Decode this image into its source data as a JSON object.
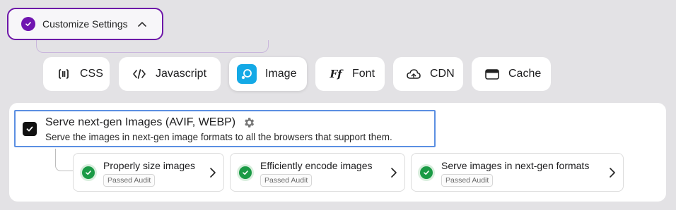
{
  "customize": {
    "label": "Customize Settings"
  },
  "tabs": [
    {
      "label": "CSS",
      "icon": "css-bracket-icon"
    },
    {
      "label": "Javascript",
      "icon": "code-icon"
    },
    {
      "label": "Image",
      "icon": "image-icon",
      "active": true
    },
    {
      "label": "Font",
      "icon": "font-icon"
    },
    {
      "label": "CDN",
      "icon": "cloud-icon"
    },
    {
      "label": "Cache",
      "icon": "cache-card-icon"
    }
  ],
  "feature": {
    "title": "Serve next-gen Images (AVIF, WEBP)",
    "description": "Serve the images in next-gen image formats to all the browsers that support them.",
    "checked": true
  },
  "audits": [
    {
      "name": "Properly size images",
      "badge": "Passed Audit"
    },
    {
      "name": "Efficiently encode images",
      "badge": "Passed Audit"
    },
    {
      "name": "Serve images in next-gen formats",
      "badge": "Passed Audit"
    }
  ],
  "colors": {
    "accent": "#7015b0",
    "image_icon": "#14a9e6",
    "pass": "#1a9a45",
    "focus": "#5b8fe2"
  }
}
